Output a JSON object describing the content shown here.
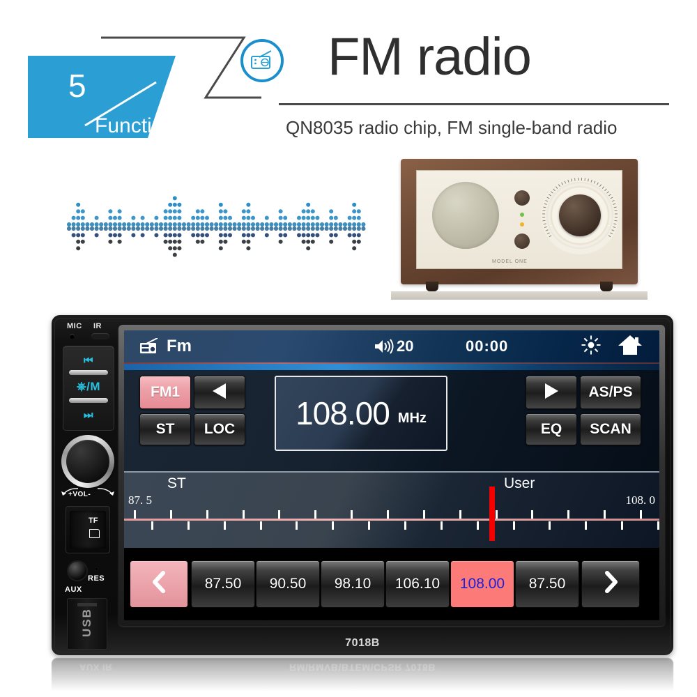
{
  "header": {
    "badge_number": "5",
    "badge_label": "Function",
    "title": "FM radio",
    "title_icon": "radio-icon",
    "subtitle": "QN8035 radio chip, FM single-band radio",
    "accent_color": "#2b9fd4"
  },
  "vintage_radio": {
    "brand_label": "MODEL ONE"
  },
  "stereo": {
    "model_number": "7018B",
    "left_panel": {
      "mic_label": "MIC",
      "ir_label": "IR",
      "prev_key": "prev-track",
      "power_key": "⏻/M",
      "next_key": "next-track",
      "volume_label": "+VOL-",
      "tf_label": "TF",
      "aux_label": "AUX",
      "res_label": "RES",
      "usb_label": "USB"
    },
    "status_bar": {
      "source": "Fm",
      "source_icon": "radio-icon",
      "volume_icon": "speaker-icon",
      "volume": "20",
      "clock": "00:00",
      "brightness_icon": "sun-icon",
      "home_icon": "home-icon"
    },
    "controls": {
      "band": "FM1",
      "prev_icon": "triangle-left-icon",
      "st": "ST",
      "loc": "LOC",
      "next_icon": "triangle-right-icon",
      "asps": "AS/PS",
      "eq": "EQ",
      "scan": "SCAN"
    },
    "frequency": {
      "value": "108.00",
      "unit": "MHz"
    },
    "tuner": {
      "stereo_label": "ST",
      "user_label": "User",
      "min": "87. 5",
      "max": "108. 0",
      "cursor_color": "#f40000"
    },
    "presets": {
      "prev_icon": "chevron-left-icon",
      "next_icon": "chevron-right-icon",
      "items": [
        {
          "label": "87.50",
          "active": false
        },
        {
          "label": "90.50",
          "active": false
        },
        {
          "label": "98.10",
          "active": false
        },
        {
          "label": "106.10",
          "active": false
        },
        {
          "label": "108.00",
          "active": true
        },
        {
          "label": "87.50",
          "active": false
        }
      ]
    },
    "reflection_text": "RM\\RMVB\\BTEM\\CPSR      7018B",
    "reflection_text_left": "AUX  IR"
  }
}
